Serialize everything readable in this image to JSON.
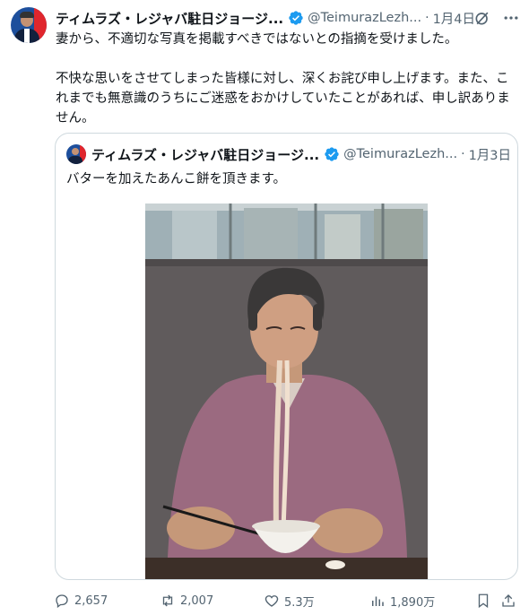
{
  "tweet": {
    "author_name": "ティムラズ・レジャバ駐日ジョージ...",
    "handle": "@TeimurazLezh...",
    "separator": "·",
    "date": "1月4日",
    "lines": [
      "妻から、不適切な写真を掲載すべきではないとの指摘を受けました。",
      "不快な思いをさせてしまった皆様に対し、深くお詫び申し上げます。また、これまでも無意識のうちにご迷惑をおかけしていたことがあれば、申し訳ありません。"
    ]
  },
  "quoted": {
    "author_name": "ティムラズ・レジャバ駐日ジョージ...",
    "handle": "@TeimurazLezh...",
    "separator": "·",
    "date": "1月3日",
    "text": "バターを加えたあんこ餅を頂きます。"
  },
  "actions": {
    "replies": "2,657",
    "reposts": "2,007",
    "likes": "5.3万",
    "views": "1,890万"
  },
  "icons": {
    "verified": "verified-badge-icon",
    "grok": "grok-icon",
    "more": "more-icon",
    "reply": "reply-icon",
    "repost": "repost-icon",
    "like": "like-icon",
    "views": "views-icon",
    "bookmark": "bookmark-icon",
    "share": "share-icon"
  },
  "colors": {
    "text": "#0f1419",
    "secondary": "#536471",
    "verified": "#1d9bf0",
    "border": "#cfd9de"
  }
}
